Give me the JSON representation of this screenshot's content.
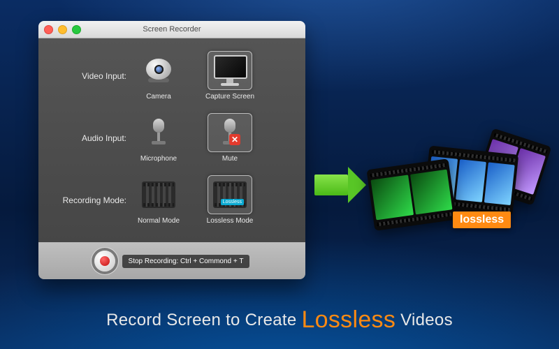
{
  "window": {
    "title": "Screen Recorder"
  },
  "rows": {
    "video": {
      "label": "Video Input:",
      "options": {
        "camera": "Camera",
        "capture": "Capture Screen"
      },
      "selected": "capture"
    },
    "audio": {
      "label": "Audio Input:",
      "options": {
        "mic": "Microphone",
        "mute": "Mute"
      },
      "selected": "mute"
    },
    "mode": {
      "label": "Recording Mode:",
      "options": {
        "normal": "Normal Mode",
        "lossless": "Lossless Mode"
      },
      "selected": "lossless",
      "lossless_tag": "Lossless"
    }
  },
  "footer": {
    "hint": "Stop Recording: Ctrl + Commond + T"
  },
  "promo": {
    "film_tag": "lossless",
    "tagline_pre": "Record Screen to Create ",
    "tagline_hl": "Lossless",
    "tagline_post": " Videos"
  },
  "colors": {
    "accent_orange": "#ff8a12",
    "accent_green": "#58c626"
  }
}
